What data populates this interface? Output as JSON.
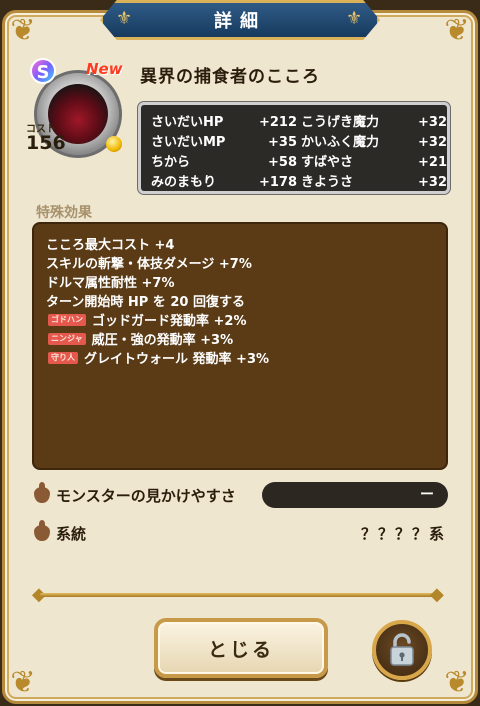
{
  "window": {
    "title": "詳細"
  },
  "monster": {
    "rank": "S",
    "new_badge": "New",
    "cost_label": "コスト",
    "cost": "156",
    "name": "異界の捕食者のこころ"
  },
  "stats": [
    {
      "label": "さいだいHP",
      "value": "+212"
    },
    {
      "label": "こうげき魔力",
      "value": "+32"
    },
    {
      "label": "さいだいMP",
      "value": "+35"
    },
    {
      "label": "かいふく魔力",
      "value": "+32"
    },
    {
      "label": "ちから",
      "value": "+58"
    },
    {
      "label": "すばやさ",
      "value": "+21"
    },
    {
      "label": "みのまもり",
      "value": "+178"
    },
    {
      "label": "きようさ",
      "value": "+32"
    }
  ],
  "effects_section": {
    "label": "特殊効果",
    "items": [
      {
        "tag": "",
        "text": "こころ最大コスト +4"
      },
      {
        "tag": "",
        "text": "スキルの斬撃・体技ダメージ +7%"
      },
      {
        "tag": "",
        "text": "ドルマ属性耐性 +7%"
      },
      {
        "tag": "",
        "text": "ターン開始時 HP を 20 回復する"
      },
      {
        "tag": "ゴドハン",
        "text": "ゴッドガード発動率 +2%"
      },
      {
        "tag": "ニンジャ",
        "text": "威圧・強の発動率 +3%"
      },
      {
        "tag": "守り人",
        "text": "グレイトウォール 発動率 +3%"
      }
    ]
  },
  "appearance": {
    "label": "モンスターの見かけやすさ",
    "value": "ー"
  },
  "lineage": {
    "label": "系統",
    "value": "？？？？系"
  },
  "buttons": {
    "close": "とじる"
  },
  "colors": {
    "accent_gold": "#c79a4a",
    "panel_brown": "#5b3b16",
    "title_blue": "#2f5b86",
    "tag_red": "#e4584e"
  }
}
